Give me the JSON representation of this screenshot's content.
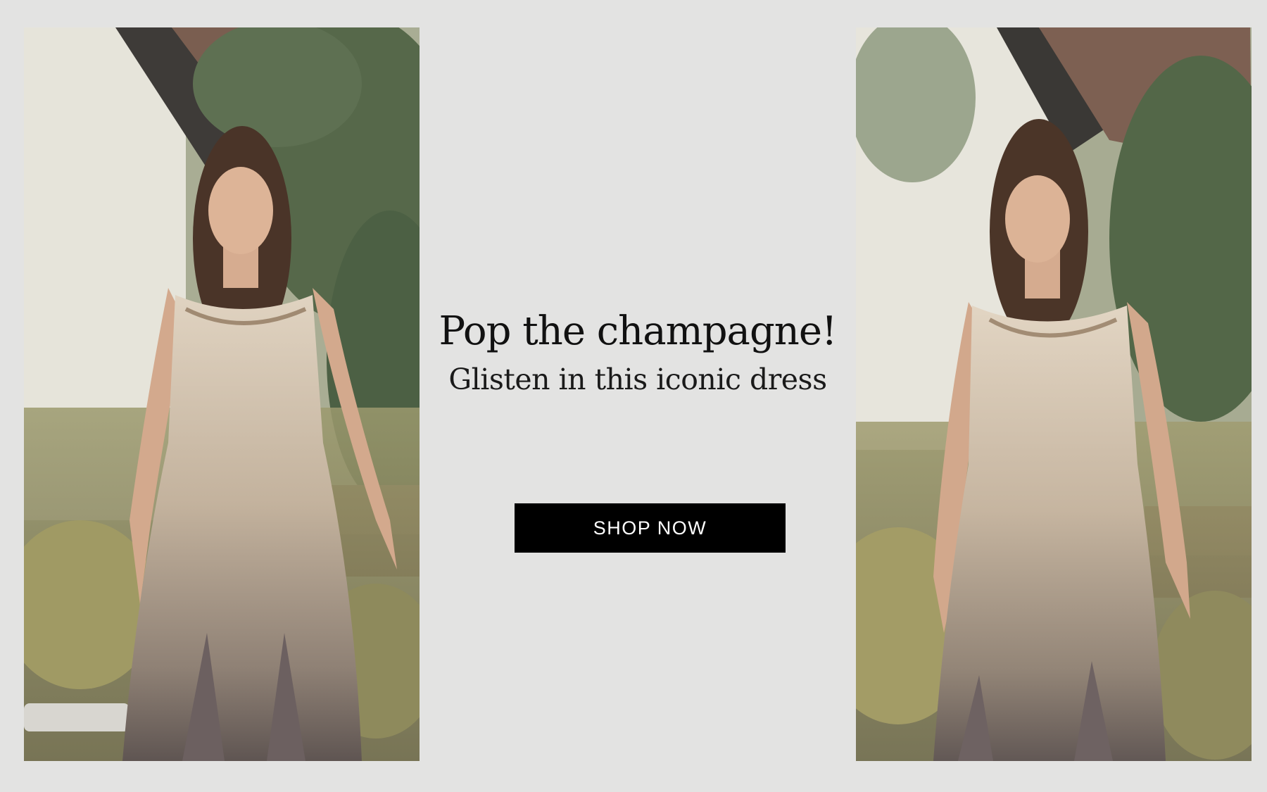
{
  "hero": {
    "headline": "Pop the champagne!",
    "subheadline": "Glisten in this iconic dress",
    "cta_label": "SHOP NOW"
  },
  "images": {
    "left": "model-in-champagne-dress-front-view",
    "right": "model-in-champagne-dress-three-quarter-view"
  },
  "colors": {
    "background": "#e3e3e2",
    "button": "#000000",
    "button_text": "#ffffff",
    "dress": "#cbb9a2"
  }
}
